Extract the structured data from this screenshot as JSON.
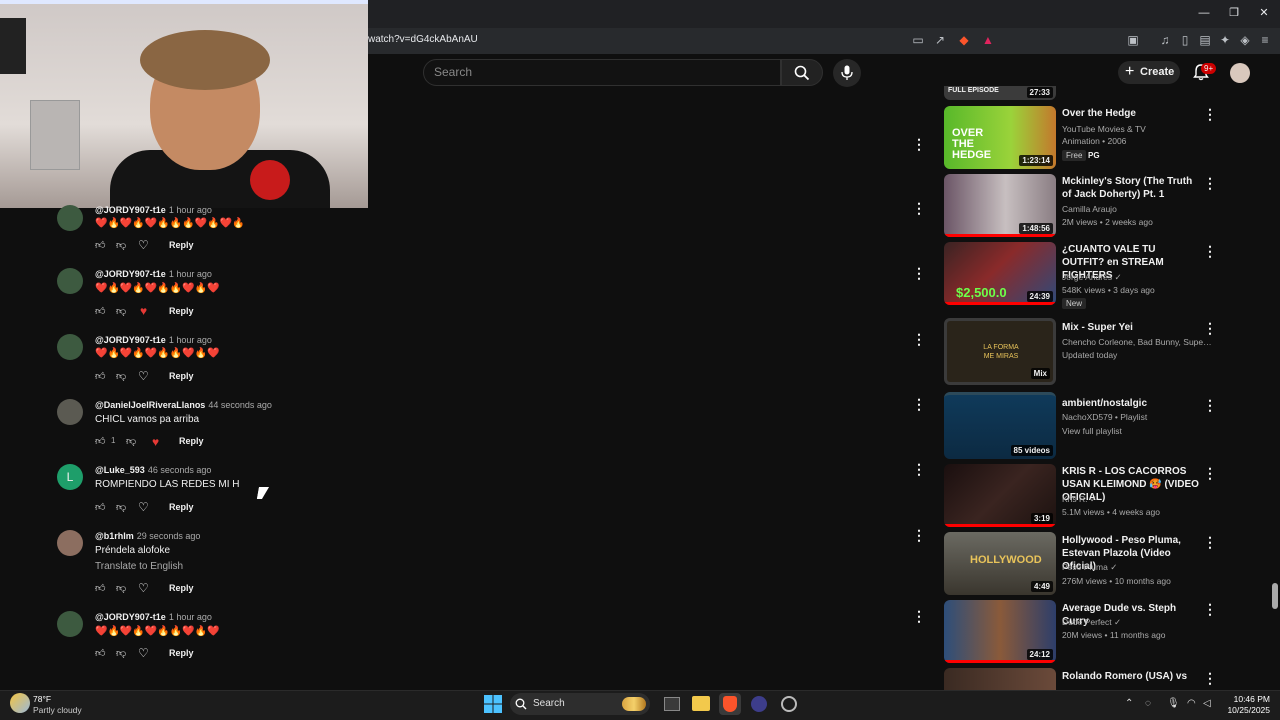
{
  "browser": {
    "url": "watch?v=dG4ckAbAnAU",
    "window_controls": [
      "—",
      "❐",
      "✕"
    ]
  },
  "header": {
    "search_placeholder": "Search",
    "create_label": "Create",
    "notification_count": "9+"
  },
  "comments": [
    {
      "author": "@JORDY907-t1e",
      "time": "1 hour ago",
      "text": "❤️🔥❤️🔥❤️🔥🔥🔥❤️🔥❤️🔥",
      "likes": "",
      "reply": "Reply"
    },
    {
      "author": "@JORDY907-t1e",
      "time": "1 hour ago",
      "text": "❤️🔥❤️🔥❤️🔥🔥❤️🔥❤️",
      "likes": "",
      "reply": "Reply"
    },
    {
      "author": "@JORDY907-t1e",
      "time": "1 hour ago",
      "text": "❤️🔥❤️🔥❤️🔥🔥❤️🔥❤️",
      "likes": "",
      "reply": "Reply"
    },
    {
      "author": "@DanielJoelRiveraLlanos",
      "time": "44 seconds ago",
      "text": "CHICL  vamos pa arriba",
      "likes": "1",
      "reply": "Reply"
    },
    {
      "author": "@Luke_593",
      "time": "46 seconds ago",
      "text": "ROMPIENDO LAS REDES MI H",
      "likes": "",
      "reply": "Reply",
      "avatar_letter": "L"
    },
    {
      "author": "@b1rhlm",
      "time": "29 seconds ago",
      "text": "Préndela alofoke",
      "translate": "Translate to English",
      "likes": "",
      "reply": "Reply"
    },
    {
      "author": "@JORDY907-t1e",
      "time": "1 hour ago",
      "text": "❤️🔥❤️🔥❤️🔥🔥❤️🔥❤️",
      "likes": "",
      "reply": "Reply"
    }
  ],
  "sidebar": {
    "top_partial": {
      "label": "FULL EPISODE",
      "duration": "27:33"
    },
    "videos": [
      {
        "title": "Over the Hedge",
        "meta1": "YouTube Movies & TV",
        "meta2": "Animation • 2006",
        "duration": "1:23:14",
        "badge": "Free",
        "rating": "PG",
        "thumb_label": "OVER THE HEDGE"
      },
      {
        "title": "Mckinley's Story (The Truth of Jack Doherty) Pt. 1",
        "meta1": "Camilla Araujo",
        "meta2": "2M views • 2 weeks ago",
        "duration": "1:48:56"
      },
      {
        "title": "¿CUANTO VALE TU OUTFIT? en STREAM FIGHTERS",
        "meta1": "Jorge Andrés ✓",
        "meta2": "548K views • 3 days ago",
        "duration": "24:39",
        "badge": "New",
        "thumb_label": "$2,500.0"
      },
      {
        "title": "Mix - Super Yei",
        "meta1": "Chencho Corleone, Bad Bunny, Super Yei,...",
        "meta2": "Updated today",
        "duration": "Mix",
        "thumb_label": "LA FORMA ME MIRAS"
      },
      {
        "title": "ambient/nostalgic",
        "meta1": "NachoXD579 • Playlist",
        "meta2": "View full playlist",
        "duration": "85 videos"
      },
      {
        "title": "KRIS R - LOS CACORROS USAN KLEIMOND 🥵 (VIDEO OFICIAL)",
        "meta1": "Kris R. ✓",
        "meta2": "5.1M views • 4 weeks ago",
        "duration": "3:19"
      },
      {
        "title": "Hollywood - Peso Pluma, Estevan Plazola (Video Oficial)",
        "meta1": "Peso Pluma ✓",
        "meta2": "276M views • 10 months ago",
        "duration": "4:49",
        "thumb_label": "HOLLYWOOD"
      },
      {
        "title": "Average Dude vs. Steph Curry",
        "meta1": "Dude Perfect ✓",
        "meta2": "20M views • 11 months ago",
        "duration": "24:12"
      },
      {
        "title": "Rolando Romero (USA) vs",
        "meta1": "",
        "meta2": "",
        "duration": ""
      }
    ]
  },
  "taskbar": {
    "weather_temp": "78°F",
    "weather_desc": "Partly cloudy",
    "search_label": "Search",
    "time": "10:46 PM",
    "date": "10/25/2025"
  }
}
